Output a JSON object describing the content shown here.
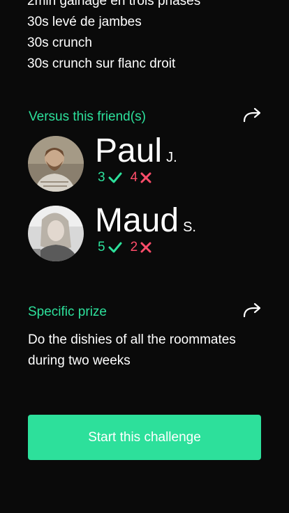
{
  "exercises": [
    "2min gainage en trois phases",
    "30s levé de jambes",
    "30s crunch",
    "30s crunch sur flanc droit"
  ],
  "versus": {
    "title": "Versus this friend(s)",
    "friends": [
      {
        "first_name": "Paul",
        "last_initial": "J.",
        "wins": "3",
        "losses": "4"
      },
      {
        "first_name": "Maud",
        "last_initial": "S.",
        "wins": "5",
        "losses": "2"
      }
    ]
  },
  "prize": {
    "title": "Specific prize",
    "text": "Do the dishies of all the roommates during two weeks"
  },
  "start_button": "Start this challenge",
  "colors": {
    "accent": "#2de09b",
    "loss": "#ff4d6a",
    "background": "#0a0a0a"
  },
  "icons": {
    "share": "share-arrow-icon",
    "win": "check-icon",
    "loss": "cross-icon"
  }
}
